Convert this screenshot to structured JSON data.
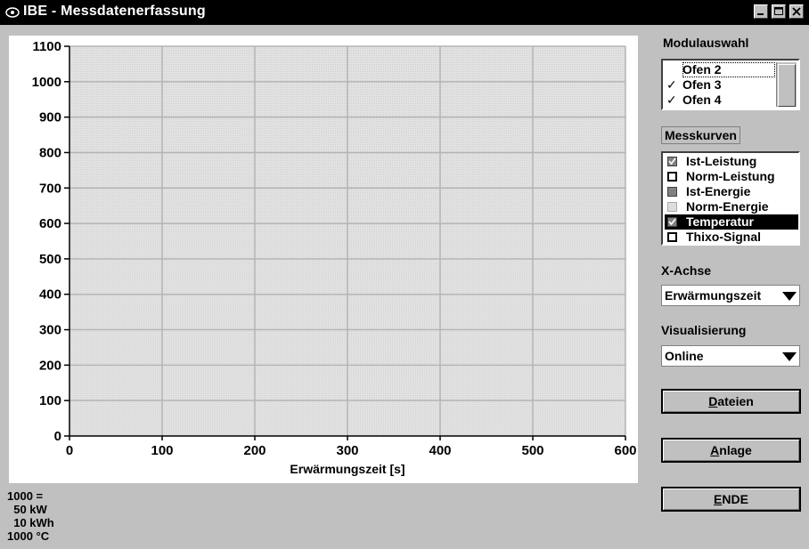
{
  "window": {
    "title": "IBE - Messdatenerfassung"
  },
  "modulauswahl": {
    "title": "Modulauswahl",
    "items": [
      {
        "label": "Ofen 2",
        "checked": false,
        "focused": true
      },
      {
        "label": "Ofen 3",
        "checked": true
      },
      {
        "label": "Ofen 4",
        "checked": true
      }
    ]
  },
  "messkurven": {
    "title": "Messkurven",
    "items": [
      {
        "label": "Ist-Leistung",
        "checked": true,
        "swatch": "grey"
      },
      {
        "label": "Norm-Leistung",
        "checked": false,
        "swatch": "black"
      },
      {
        "label": "Ist-Energie",
        "checked": false,
        "swatch": "grey"
      },
      {
        "label": "Norm-Energie",
        "checked": false,
        "swatch": "white"
      },
      {
        "label": "Temperatur",
        "checked": true,
        "swatch": "grey",
        "selected": true
      },
      {
        "label": "Thixo-Signal",
        "checked": false,
        "swatch": "black"
      }
    ]
  },
  "xachse": {
    "title": "X-Achse",
    "value": "Erwärmungszeit"
  },
  "visualisierung": {
    "title": "Visualisierung",
    "value": "Online"
  },
  "buttons": {
    "dateien": {
      "underline": "D",
      "rest": "ateien"
    },
    "anlage": {
      "underline": "A",
      "rest": "nlage"
    },
    "ende": {
      "underline": "E",
      "rest": "NDE"
    }
  },
  "note": [
    "1000 =",
    "  50 kW",
    "  10 kWh",
    "1000 °C"
  ],
  "chart_data": {
    "type": "line",
    "xlabel": "Erwärmungszeit [s]",
    "ylabel": "",
    "xlim": [
      0,
      600
    ],
    "ylim": [
      0,
      1100
    ],
    "x_ticks": [
      0,
      100,
      200,
      300,
      400,
      500,
      600
    ],
    "y_ticks": [
      0,
      100,
      200,
      300,
      400,
      500,
      600,
      700,
      800,
      900,
      1000,
      1100
    ],
    "grid": true,
    "series": [],
    "colors": {
      "plot_bg": "#e3e3e3",
      "grid": "#b4b4b4"
    }
  }
}
